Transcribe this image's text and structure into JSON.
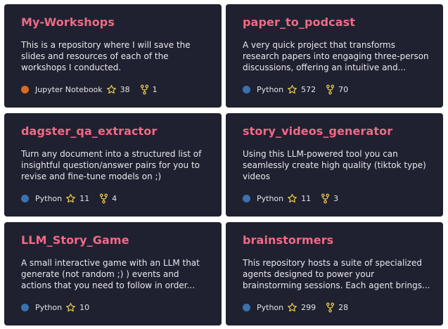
{
  "colors": {
    "card_bg": "#1f2130",
    "title": "#f06a86",
    "star": "#e7c44a",
    "fork": "#e7c44a",
    "jupyter": "#dc6a1e",
    "python": "#3a72b0"
  },
  "repos": [
    {
      "name": "My-Workshops",
      "description": "This is a repository where I will save the slides and resources of each of the workshops I conducted.",
      "language": "Jupyter Notebook",
      "language_color": "#dc6a1e",
      "stars": "38",
      "forks": "1",
      "star_icon": "star-icon",
      "fork_icon": "fork-icon"
    },
    {
      "name": "paper_to_podcast",
      "description": "A very quick project that transforms research papers into engaging three-person discussions, offering an intuitive and...",
      "language": "Python",
      "language_color": "#3a72b0",
      "stars": "572",
      "forks": "70",
      "star_icon": "star-icon",
      "fork_icon": "fork-icon"
    },
    {
      "name": "dagster_qa_extractor",
      "description": "Turn any document into a structured list of insightful question/answer pairs for you to revise and fine-tune models on ;)",
      "language": "Python",
      "language_color": "#3a72b0",
      "stars": "11",
      "forks": "4",
      "star_icon": "star-icon",
      "fork_icon": "fork-icon"
    },
    {
      "name": "story_videos_generator",
      "description": "Using this LLM-powered tool you can seamlessly create high quality (tiktok type) videos",
      "language": "Python",
      "language_color": "#3a72b0",
      "stars": "11",
      "forks": "3",
      "star_icon": "star-icon",
      "fork_icon": "fork-icon"
    },
    {
      "name": "LLM_Story_Game",
      "description": "A small interactive game with an LLM that generate (not random ;) ) events and actions that you need to follow in order...",
      "language": "Python",
      "language_color": "#3a72b0",
      "stars": "10",
      "forks": null,
      "star_icon": "star-icon",
      "fork_icon": null
    },
    {
      "name": "brainstormers",
      "description": "This repository hosts a suite of specialized agents designed to power your brainstorming sessions. Each agent brings...",
      "language": "Python",
      "language_color": "#3a72b0",
      "stars": "299",
      "forks": "28",
      "star_icon": "star-icon",
      "fork_icon": "fork-icon"
    }
  ]
}
